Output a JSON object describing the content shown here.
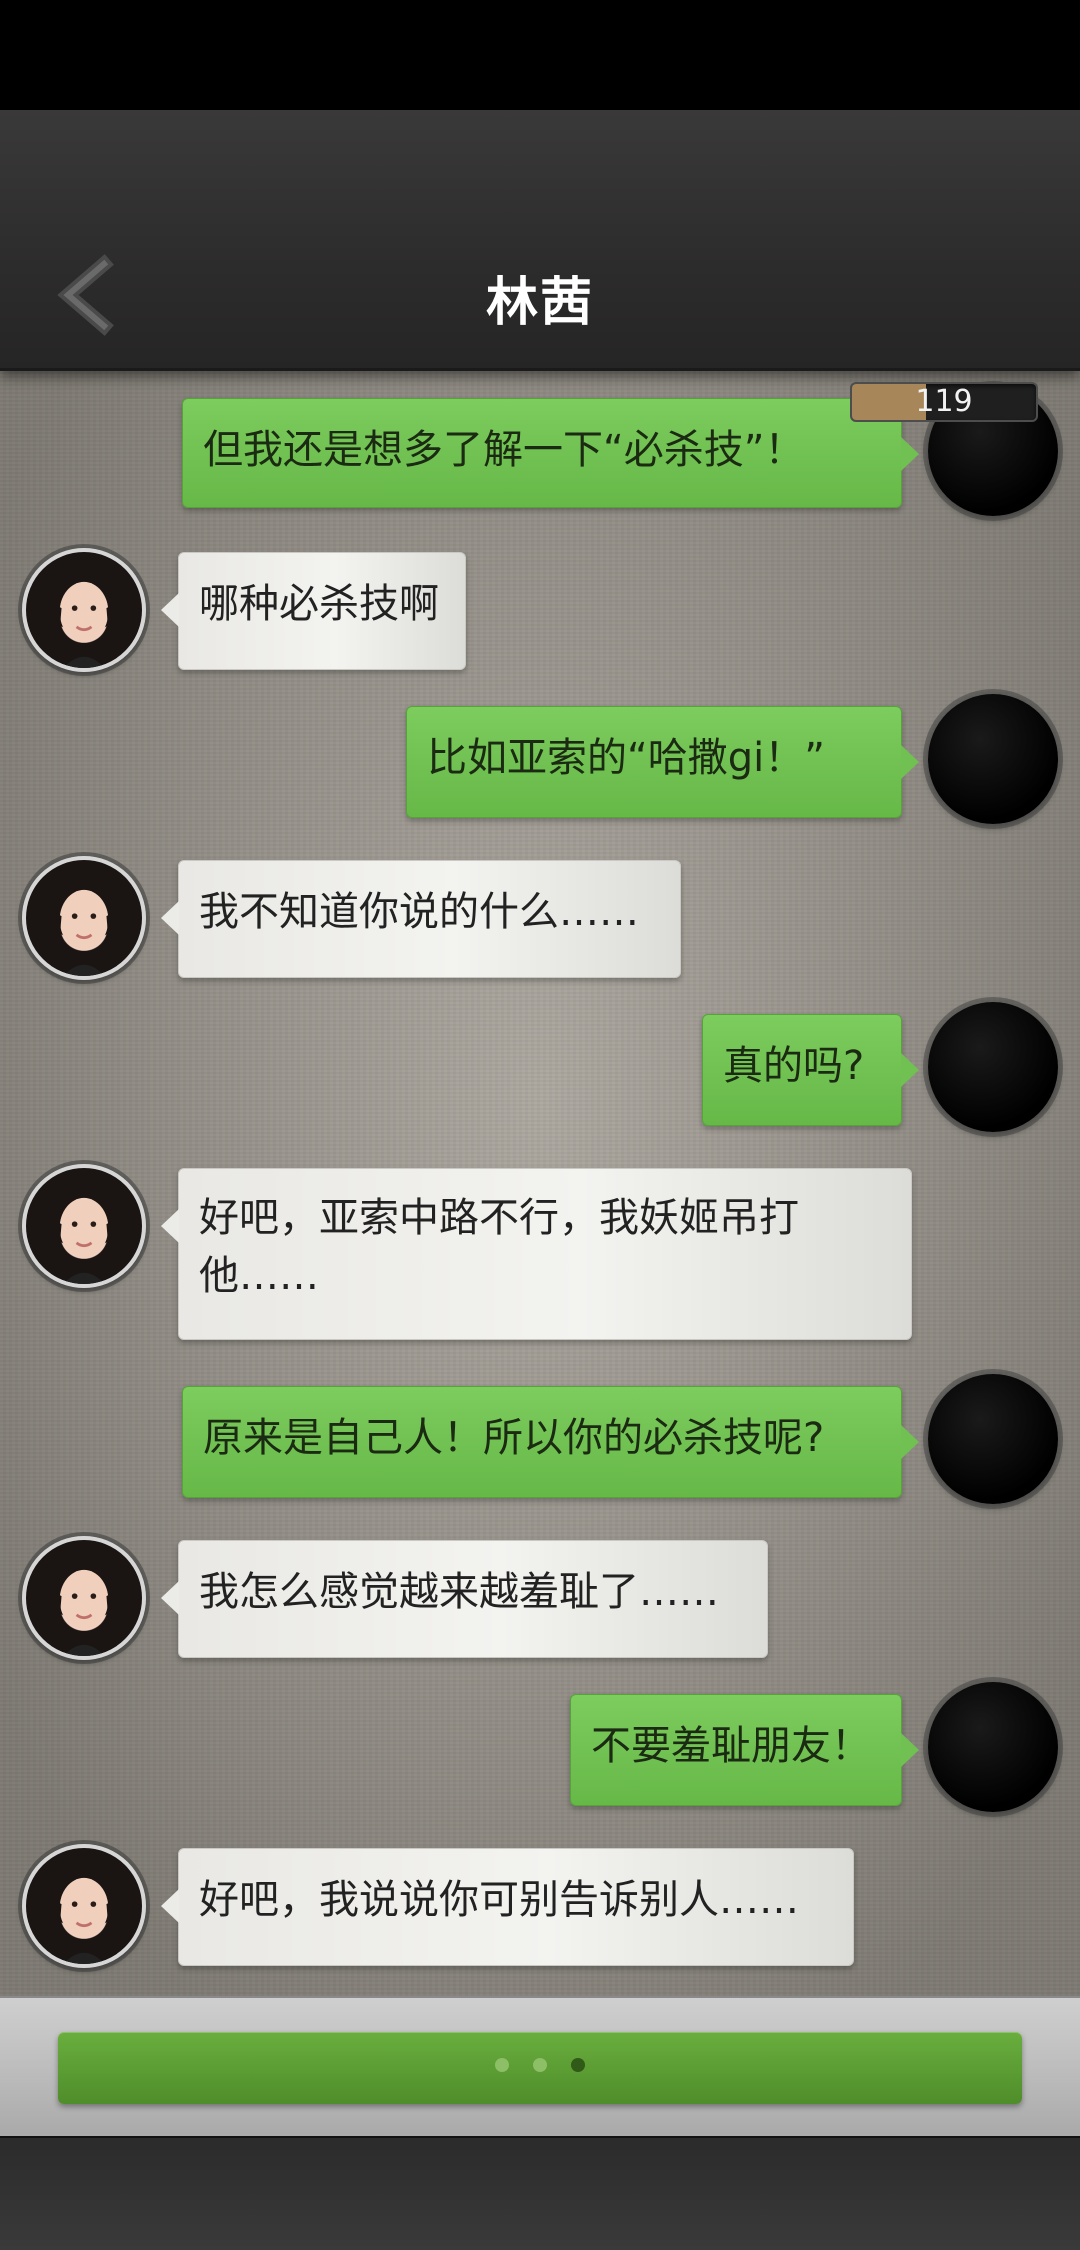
{
  "header": {
    "title": "林茜",
    "back_icon": "chevron-left-icon",
    "energy_value": "119",
    "energy_fill_fraction": 0.4,
    "energy_color": "#a7875a"
  },
  "messages": [
    {
      "sender": "me",
      "text": "但我还是想多了解一下“必杀技”！"
    },
    {
      "sender": "her",
      "text": "哪种必杀技啊"
    },
    {
      "sender": "me",
      "text": "比如亚索的“哈撒gi！”"
    },
    {
      "sender": "her",
      "text": "我不知道你说的什么……"
    },
    {
      "sender": "me",
      "text": "真的吗?"
    },
    {
      "sender": "her",
      "text": "好吧，亚索中路不行，我妖姬吊打他……"
    },
    {
      "sender": "me",
      "text": "原来是自己人！所以你的必杀技呢?"
    },
    {
      "sender": "her",
      "text": "我怎么感觉越来越羞耻了……"
    },
    {
      "sender": "me",
      "text": "不要羞耻朋友！"
    },
    {
      "sender": "her",
      "text": "好吧，我说说你可别告诉别人……"
    }
  ],
  "footer": {
    "continue_icon": "typing-dots-icon",
    "dot_colors": [
      "#8cbf66",
      "#8cbf66",
      "#2f5a18"
    ]
  },
  "colors": {
    "outgoing_bubble": "#70c052",
    "incoming_bubble": "#ebebe7",
    "chat_background": "#a29d94"
  }
}
